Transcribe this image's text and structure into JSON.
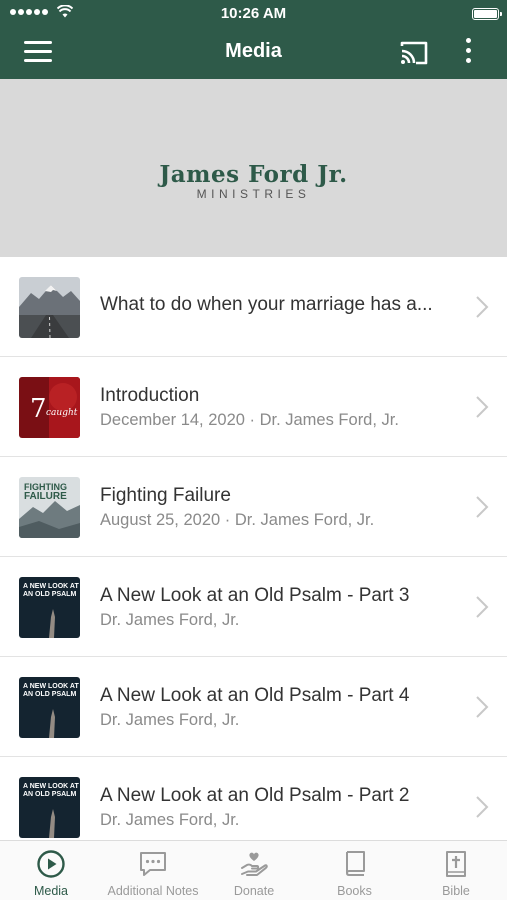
{
  "status_bar": {
    "time": "10:26 AM"
  },
  "nav": {
    "title": "Media"
  },
  "banner": {
    "logo_main": "James Ford Jr.",
    "logo_sub": "MINISTRIES"
  },
  "items": [
    {
      "title": "What to do when your marriage has a...",
      "subtitle": "",
      "thumb": "road-mountain"
    },
    {
      "title": "Introduction",
      "subtitle": "December 14, 2020 · Dr. James Ford, Jr.",
      "thumb": "red-seven"
    },
    {
      "title": "Fighting Failure",
      "subtitle": "August 25, 2020 · Dr. James Ford, Jr.",
      "thumb": "fighting-failure"
    },
    {
      "title": "A New Look at an Old Psalm - Part 3",
      "subtitle": "Dr. James Ford, Jr.",
      "thumb": "old-psalm"
    },
    {
      "title": "A New Look at an Old Psalm - Part 4",
      "subtitle": "Dr. James Ford, Jr.",
      "thumb": "old-psalm"
    },
    {
      "title": "A New Look at an Old Psalm - Part 2",
      "subtitle": "Dr. James Ford, Jr.",
      "thumb": "old-psalm"
    }
  ],
  "thumb_text": {
    "red_seven": {
      "num": "7",
      "word": "caught"
    },
    "fighting_failure": {
      "line1": "FIGHTING",
      "line2": "FAILURE"
    },
    "old_psalm": {
      "line1": "A NEW LOOK AT",
      "line2": "AN OLD PSALM"
    }
  },
  "tabs": [
    {
      "label": "Media",
      "icon": "play-circle-icon",
      "active": true
    },
    {
      "label": "Additional Notes",
      "icon": "chat-bubble-icon",
      "active": false
    },
    {
      "label": "Donate",
      "icon": "donate-hand-heart-icon",
      "active": false
    },
    {
      "label": "Books",
      "icon": "book-icon",
      "active": false
    },
    {
      "label": "Bible",
      "icon": "bible-cross-icon",
      "active": false
    }
  ],
  "colors": {
    "brand": "#2e5a49",
    "banner_bg": "#d9d9d9",
    "tab_inactive": "#9a9a9a",
    "subtitle": "#8a8a8a"
  }
}
